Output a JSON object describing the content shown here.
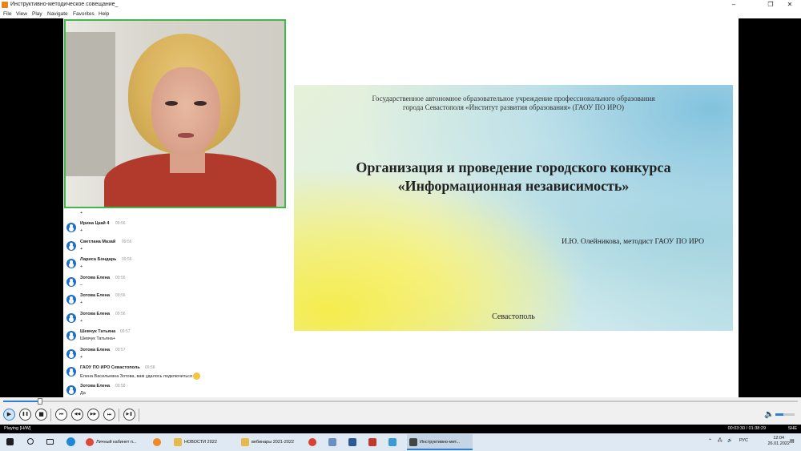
{
  "window": {
    "title": "Инструктивно-методическое совещание_",
    "minimize": "–",
    "maximize": "❐",
    "close": "✕"
  },
  "menu": [
    "File",
    "View",
    "Play",
    "Navigate",
    "Favorites",
    "Help"
  ],
  "chat": [
    {
      "name": "",
      "time": "",
      "msg": "+"
    },
    {
      "name": "Ирина Цкай 4",
      "time": "09:56",
      "msg": "+"
    },
    {
      "name": "Светлана Мазай",
      "time": "09:56",
      "msg": "+"
    },
    {
      "name": "Лариса Бондарь",
      "time": "09:56",
      "msg": "+"
    },
    {
      "name": "Зотова Елена",
      "time": "09:56",
      "msg": "–"
    },
    {
      "name": "Зотова Елена",
      "time": "09:56",
      "msg": "+"
    },
    {
      "name": "Зотова Елена",
      "time": "09:56",
      "msg": "+"
    },
    {
      "name": "Шевчук Татьяна",
      "time": "09:57",
      "msg": "Шевчук Татьяна+"
    },
    {
      "name": "Зотова Елена",
      "time": "09:57",
      "msg": "+"
    },
    {
      "name": "ГАОУ ПО ИРО Севастополь",
      "time": "09:58",
      "msg": "Елена Васильевна Зотова, вам удалось подключиться"
    },
    {
      "name": "Зотова Елена",
      "time": "09:58",
      "msg": "Да"
    }
  ],
  "slide": {
    "org_line1": "Государственное автономное образовательное учреждение профессионального образования",
    "org_line2": "города Севастополя «Институт развития образования» (ГАОУ ПО ИРО)",
    "title_line1": "Организация и проведение городского конкурса",
    "title_line2": "«Информационная независимость»",
    "author": "И.Ю. Олейникова, методист ГАОУ ПО ИРО",
    "city": "Севастополь"
  },
  "player": {
    "progress": 0.046,
    "volume": 0.4,
    "buttons": {
      "play": "▶",
      "pause": "❚❚",
      "stop": "■",
      "prev": "⏮",
      "rewind": "◀◀",
      "forward": "▶▶",
      "next": "⏭",
      "frame": "▶❚",
      "volume": "🔈"
    }
  },
  "status": {
    "state": "Playing [H/W]",
    "time": "00:03:30 / 01:38:29",
    "mode": "SHE"
  },
  "taskbar": {
    "items": [
      {
        "label": "Личный кабинет п...",
        "color": "#e0453a"
      },
      {
        "label": "",
        "color": "#f08a24"
      },
      {
        "label": "НОВОСТИ 2022",
        "color": "#e8b84a"
      },
      {
        "label": "вебинары 2021-2022",
        "color": "#e8b84a"
      },
      {
        "label": "",
        "color": "#d9402f"
      },
      {
        "label": "",
        "color": "#6a8fc0"
      },
      {
        "label": "",
        "color": "#2b579a"
      },
      {
        "label": "",
        "color": "#c0392b"
      },
      {
        "label": "",
        "color": "#3a9ad9"
      },
      {
        "label": "Инструктивно-мет...",
        "color": "#444444"
      }
    ],
    "lang": "РУС",
    "time": "12:04",
    "date": "26.01.2022"
  }
}
